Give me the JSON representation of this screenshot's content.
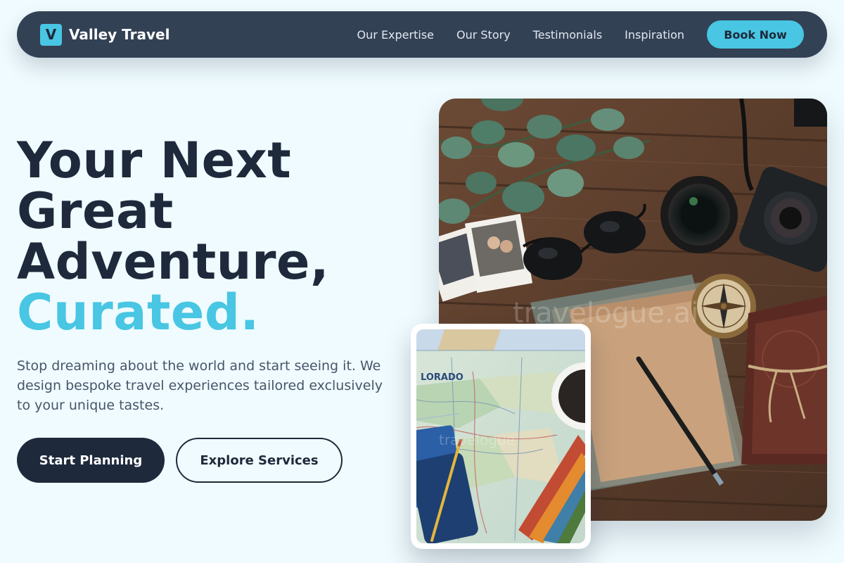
{
  "header": {
    "logo_letter": "V",
    "brand": "Valley Travel",
    "nav": [
      {
        "label": "Our Expertise"
      },
      {
        "label": "Our Story"
      },
      {
        "label": "Testimonials"
      },
      {
        "label": "Inspiration"
      }
    ],
    "cta": "Book Now"
  },
  "hero": {
    "headline_lines": [
      "Your Next",
      "Great",
      "Adventure,"
    ],
    "headline_accent": "Curated.",
    "subtext": "Stop dreaming about the world and start seeing it. We design bespoke travel experiences tailored exclusively to your unique tastes.",
    "primary_button": "Start Planning",
    "secondary_button": "Explore Services"
  },
  "images": {
    "main_watermark": "travelogue.ai",
    "map_label": "LORADO",
    "small_watermark": "travelogue"
  },
  "colors": {
    "background": "#effbfe",
    "nav": "#334155",
    "accent": "#48c6e3",
    "text_dark": "#1e293b",
    "text_muted": "#475569"
  },
  "icons": [
    "camera-icon",
    "compass-icon",
    "sunglasses-icon",
    "pencil-icon",
    "map-icon"
  ]
}
